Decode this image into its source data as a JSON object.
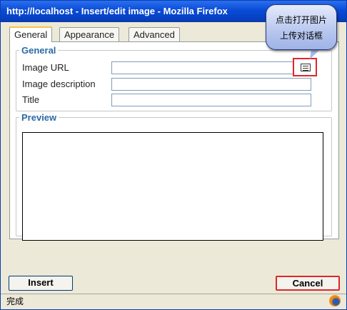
{
  "window": {
    "title": "http://localhost - Insert/edit image - Mozilla Firefox"
  },
  "tabs": [
    {
      "label": "General",
      "active": true
    },
    {
      "label": "Appearance",
      "active": false
    },
    {
      "label": "Advanced",
      "active": false
    }
  ],
  "general": {
    "legend": "General",
    "image_url_label": "Image URL",
    "image_url_value": "",
    "image_description_label": "Image description",
    "image_description_value": "",
    "title_label": "Title",
    "title_value": ""
  },
  "preview": {
    "legend": "Preview"
  },
  "buttons": {
    "insert": "Insert",
    "cancel": "Cancel"
  },
  "status": {
    "text": "完成"
  },
  "callout": {
    "line1": "点击打开图片",
    "line2": "上传对话框"
  },
  "icons": {
    "browse": "file-browser-icon",
    "status_logo": "firefox-logo-icon"
  },
  "colors": {
    "titlebar": "#0a4bd5",
    "legend_text": "#2b6aa5",
    "highlight_border": "#e0262a",
    "active_tab_accent": "#f6c343"
  }
}
